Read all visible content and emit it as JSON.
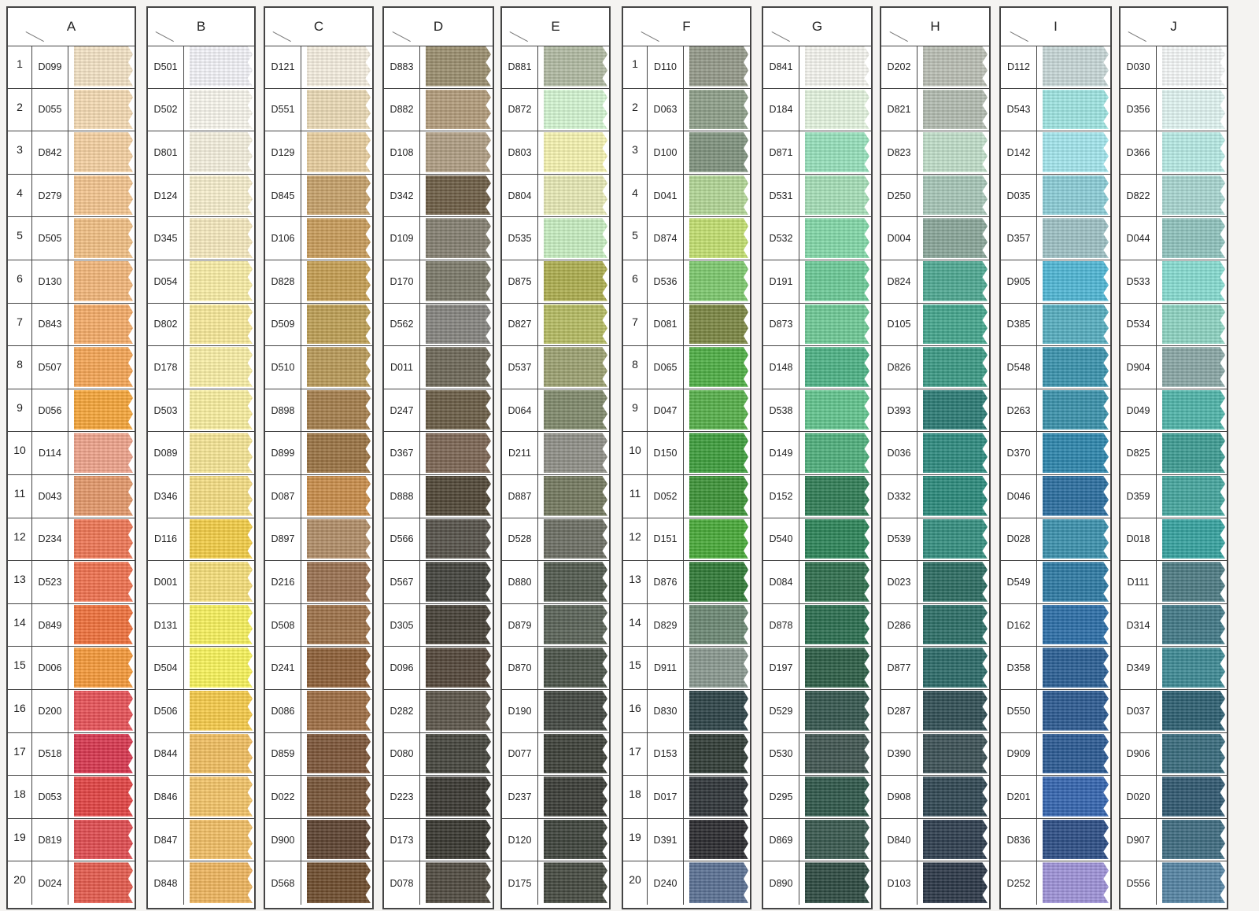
{
  "columns": [
    {
      "letter": "A",
      "numbered": true,
      "codes": [
        "D099",
        "D055",
        "D842",
        "D279",
        "D505",
        "D130",
        "D843",
        "D507",
        "D056",
        "D114",
        "D043",
        "D234",
        "D523",
        "D849",
        "D006",
        "D200",
        "D518",
        "D053",
        "D819",
        "D024"
      ],
      "colors": [
        "#f5e4c6",
        "#f7dcb4",
        "#f7d2a2",
        "#f6c690",
        "#f3c185",
        "#f4b77a",
        "#f7ad68",
        "#f7a655",
        "#f8a63a",
        "#f0a48c",
        "#e5996a",
        "#f07755",
        "#f1724f",
        "#f1723c",
        "#f79a3a",
        "#e95258",
        "#d9374f",
        "#e44343",
        "#e24c50",
        "#e65b4d"
      ]
    },
    {
      "letter": "B",
      "numbered": false,
      "codes": [
        "D501",
        "D502",
        "D801",
        "D124",
        "D345",
        "D054",
        "D802",
        "D178",
        "D503",
        "D089",
        "D346",
        "D116",
        "D001",
        "D131",
        "D504",
        "D506",
        "D844",
        "D846",
        "D847",
        "D848"
      ],
      "colors": [
        "#f4f4fa",
        "#faf8ee",
        "#f6f1df",
        "#f9f0cf",
        "#f8ebc0",
        "#fbefa6",
        "#faeb9a",
        "#fbf0a6",
        "#fbf0a0",
        "#f8e796",
        "#f7df84",
        "#f4cf47",
        "#f8e07a",
        "#f9f25d",
        "#faf55b",
        "#f8cc4a",
        "#f2c060",
        "#f5c568",
        "#f3c065",
        "#f0b65e"
      ]
    },
    {
      "letter": "C",
      "numbered": false,
      "codes": [
        "D121",
        "D551",
        "D129",
        "D845",
        "D106",
        "D828",
        "D509",
        "D510",
        "D898",
        "D899",
        "D087",
        "D897",
        "D216",
        "D508",
        "D241",
        "D086",
        "D859",
        "D022",
        "D900",
        "D568"
      ],
      "colors": [
        "#f6efe0",
        "#ecdbb6",
        "#e9cf9e",
        "#c7a26a",
        "#c99d5b",
        "#c69f52",
        "#bfa055",
        "#b99a58",
        "#a57e4c",
        "#9b7443",
        "#c98d4a",
        "#b28e68",
        "#9a7150",
        "#9e7249",
        "#8e6038",
        "#9f6e43",
        "#7c5538",
        "#775437",
        "#5d4230",
        "#6e4c2c"
      ]
    },
    {
      "letter": "D",
      "numbered": false,
      "codes": [
        "D883",
        "D882",
        "D108",
        "D342",
        "D109",
        "D170",
        "D562",
        "D011",
        "D247",
        "D367",
        "D888",
        "D566",
        "D567",
        "D305",
        "D096",
        "D282",
        "D080",
        "D223",
        "D173",
        "D078"
      ],
      "colors": [
        "#9b8f6f",
        "#b39c7b",
        "#b09e84",
        "#6e5e46",
        "#858071",
        "#7c7a6a",
        "#868580",
        "#6e6858",
        "#6a5d46",
        "#7c6654",
        "#504736",
        "#56524a",
        "#42423c",
        "#464037",
        "#53473a",
        "#5c554a",
        "#45453c",
        "#3a3832",
        "#38372f",
        "#4f4a3f"
      ]
    },
    {
      "letter": "E",
      "numbered": false,
      "codes": [
        "D881",
        "D872",
        "D803",
        "D804",
        "D535",
        "D875",
        "D827",
        "D537",
        "D064",
        "D211",
        "D887",
        "D528",
        "D880",
        "D879",
        "D870",
        "D190",
        "D077",
        "D237",
        "D120",
        "D175"
      ],
      "colors": [
        "#b2bba3",
        "#d5f7d3",
        "#f7f4b1",
        "#e9ebb6",
        "#c8efc2",
        "#aeaf4f",
        "#b6bd63",
        "#9da272",
        "#818a6c",
        "#909088",
        "#74795f",
        "#6d6f64",
        "#515a4e",
        "#5a6357",
        "#4b5349",
        "#414740",
        "#3c3f38",
        "#3a3c36",
        "#3d423b",
        "#44493f"
      ]
    },
    {
      "letter": "F",
      "numbered": true,
      "codes": [
        "D110",
        "D063",
        "D100",
        "D041",
        "D874",
        "D536",
        "D081",
        "D065",
        "D047",
        "D150",
        "D052",
        "D151",
        "D876",
        "D829",
        "D911",
        "D830",
        "D153",
        "D017",
        "D391",
        "D240"
      ],
      "colors": [
        "#959a8a",
        "#8fa08a",
        "#80937e",
        "#b3d797",
        "#c3e070",
        "#7dc96e",
        "#7b8743",
        "#4eaf45",
        "#56b04a",
        "#3d9e3c",
        "#3c9437",
        "#48aa38",
        "#2f7a36",
        "#6c8874",
        "#8a9990",
        "#2c4247",
        "#2f3b35",
        "#2e3438",
        "#2a2a2e",
        "#5a7093"
      ]
    },
    {
      "letter": "G",
      "numbered": false,
      "codes": [
        "D841",
        "D184",
        "D871",
        "D531",
        "D532",
        "D191",
        "D873",
        "D148",
        "D538",
        "D149",
        "D152",
        "D540",
        "D084",
        "D878",
        "D197",
        "D529",
        "D530",
        "D295",
        "D869",
        "D890"
      ],
      "colors": [
        "#f6f6f0",
        "#e5f5e0",
        "#97e2bc",
        "#a6e0b8",
        "#83d9a9",
        "#6ccb98",
        "#6fcb97",
        "#4db386",
        "#62c58e",
        "#4fb07c",
        "#2f7d55",
        "#2c8559",
        "#2e6f4d",
        "#2a6e4f",
        "#2c5e46",
        "#34564e",
        "#3f5550",
        "#2e574a",
        "#38584e",
        "#2c4a40"
      ]
    },
    {
      "letter": "H",
      "numbered": false,
      "codes": [
        "D202",
        "D821",
        "D823",
        "D250",
        "D004",
        "D824",
        "D105",
        "D826",
        "D393",
        "D036",
        "D332",
        "D539",
        "D023",
        "D286",
        "D877",
        "D287",
        "D390",
        "D908",
        "D840",
        "D103"
      ],
      "colors": [
        "#bbc0b5",
        "#b3bdb1",
        "#c1dfc9",
        "#a8c7b8",
        "#8aa79a",
        "#4ea992",
        "#45a68d",
        "#3b9a85",
        "#2b7b75",
        "#2d8b7f",
        "#2a8a7b",
        "#348f80",
        "#2b6c61",
        "#2b6e66",
        "#2b6a68",
        "#2f4e54",
        "#3b5055",
        "#2f4752",
        "#2d3d4e",
        "#2a3646"
      ]
    },
    {
      "letter": "I",
      "numbered": false,
      "codes": [
        "D112",
        "D543",
        "D142",
        "D035",
        "D357",
        "D905",
        "D385",
        "D548",
        "D263",
        "D370",
        "D046",
        "D028",
        "D549",
        "D162",
        "D358",
        "D550",
        "D909",
        "D201",
        "D836",
        "D252"
      ],
      "colors": [
        "#c8d8d8",
        "#9fe6e3",
        "#a3e7ee",
        "#8ccfd8",
        "#9ec2c5",
        "#4fb7d6",
        "#56afc1",
        "#3a94ae",
        "#3a92ac",
        "#2c86ad",
        "#2a6ea0",
        "#3b91ae",
        "#2d7aa4",
        "#2b6ea8",
        "#2a5f95",
        "#2b5a91",
        "#2a5a94",
        "#3465b0",
        "#2c4e86",
        "#9e92d8"
      ]
    },
    {
      "letter": "J",
      "numbered": false,
      "codes": [
        "D030",
        "D356",
        "D366",
        "D822",
        "D044",
        "D533",
        "D534",
        "D904",
        "D049",
        "D825",
        "D359",
        "D018",
        "D111",
        "D314",
        "D349",
        "D037",
        "D906",
        "D020",
        "D907",
        "D556"
      ],
      "colors": [
        "#f6f9f9",
        "#e2f6f3",
        "#b7ece6",
        "#a9d7d2",
        "#90c4bf",
        "#87ddd2",
        "#8ed5c3",
        "#8aa8a6",
        "#4fb5aa",
        "#3d9d94",
        "#45a69e",
        "#36a3a0",
        "#4d7b84",
        "#417987",
        "#3d8a95",
        "#2c5f71",
        "#386b7c",
        "#2f5870",
        "#3e6c81",
        "#5484a3"
      ]
    }
  ]
}
